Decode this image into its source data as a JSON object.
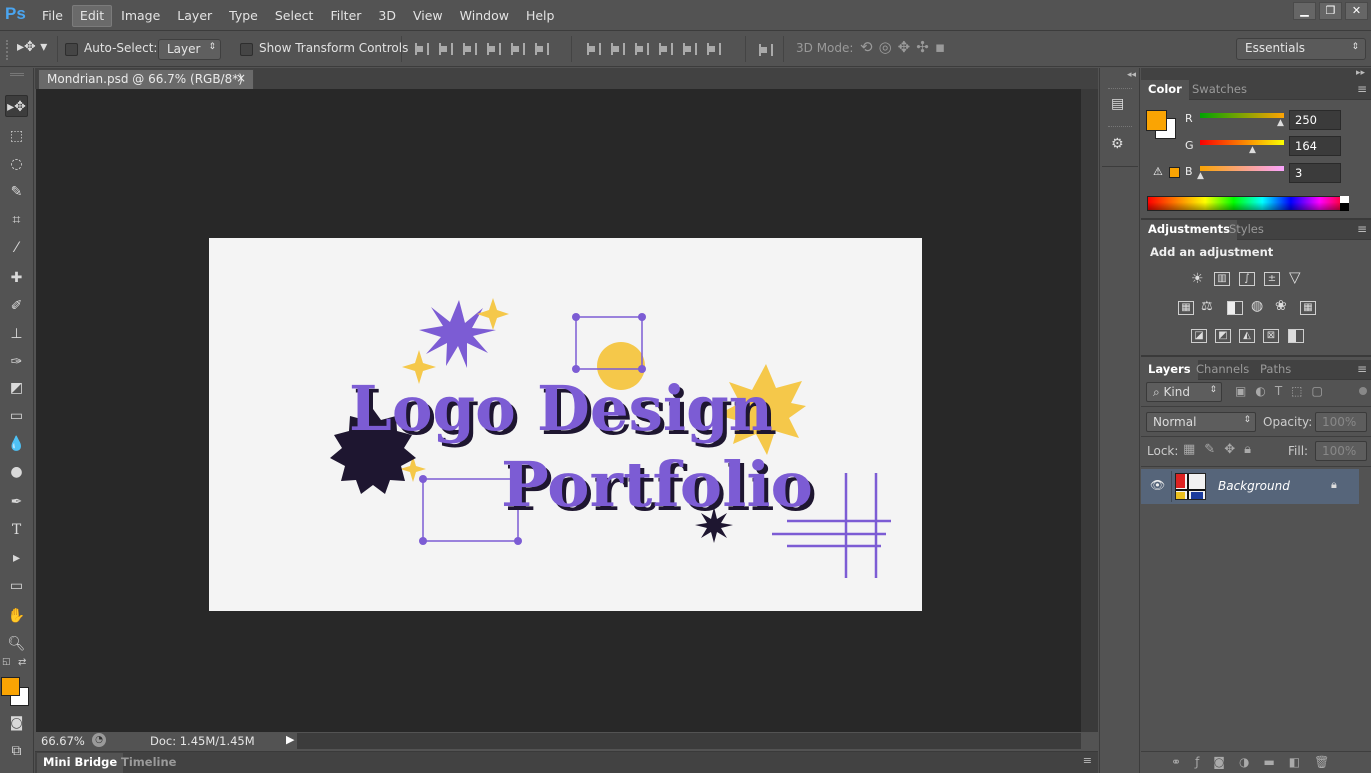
{
  "app": {
    "logo": "Ps"
  },
  "menu": [
    "File",
    "Edit",
    "Image",
    "Layer",
    "Type",
    "Select",
    "Filter",
    "3D",
    "View",
    "Window",
    "Help"
  ],
  "menu_active": "Edit",
  "options": {
    "auto_select_label": "Auto-Select:",
    "auto_select_value": "Layer",
    "show_transform_label": "Show Transform Controls",
    "mode_3d_label": "3D Mode:",
    "workspace": "Essentials"
  },
  "document": {
    "tab_title": "Mondrian.psd @ 66.7% (RGB/8*)",
    "close_glyph": "×",
    "zoom": "66.67%",
    "doc_size": "Doc: 1.45M/1.45M"
  },
  "artwork": {
    "line1": "Logo Design",
    "line2": "Portfolio",
    "text_color": "#7c5cd4",
    "shadow_color": "#1e1630",
    "accent_yellow": "#f5c84a",
    "canvas_bg": "#f4f4f4"
  },
  "bottom_tabs": [
    "Mini Bridge",
    "Timeline"
  ],
  "color_panel": {
    "tabs": [
      "Color",
      "Swatches"
    ],
    "foreground": "#faa403",
    "channels": [
      {
        "label": "R",
        "value": "250"
      },
      {
        "label": "G",
        "value": "164"
      },
      {
        "label": "B",
        "value": "3"
      }
    ]
  },
  "adjustments_panel": {
    "tabs": [
      "Adjustments",
      "Styles"
    ],
    "heading": "Add an adjustment"
  },
  "layers_panel": {
    "tabs": [
      "Layers",
      "Channels",
      "Paths"
    ],
    "filter_kind": "Kind",
    "blend_mode": "Normal",
    "opacity_label": "Opacity:",
    "opacity_value": "100%",
    "lock_label": "Lock:",
    "fill_label": "Fill:",
    "fill_value": "100%",
    "layers": [
      {
        "name": "Background",
        "visible": true,
        "locked": true
      }
    ]
  }
}
